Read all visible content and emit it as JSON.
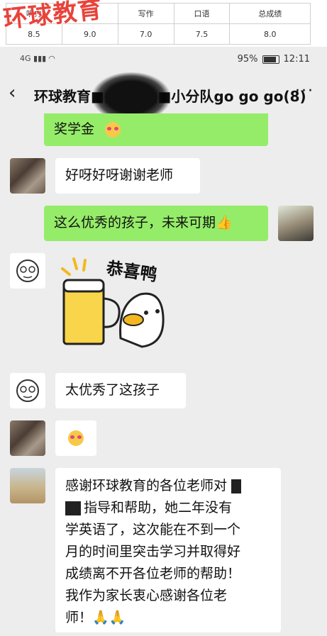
{
  "score_table": {
    "headers": [
      "听力",
      "阅读",
      "写作",
      "口语",
      "总成绩"
    ],
    "values": [
      "8.5",
      "9.0",
      "7.0",
      "7.5",
      "8.0"
    ]
  },
  "brand": {
    "text": "环球教育"
  },
  "status_bar": {
    "signal": "4G",
    "battery": "95%",
    "time": "12:11"
  },
  "chat": {
    "back_icon": "chevron-left-icon",
    "title": "环球教育■■■■■■小分队go go go(8)",
    "more": "···"
  },
  "messages": {
    "m1": "奖学金",
    "m2": "好呀好呀谢谢老师",
    "m3": "这么优秀的孩子，未来可期👍",
    "sticker_text": "恭喜鸭",
    "m5": "太优秀了这孩子",
    "m7_l1": "感谢环球教育的各位老师对",
    "m7_l2": "指导和帮助，她二年没有",
    "m7_l3": "学英语了，这次能在不到一个",
    "m7_l4": "月的时间里突击学习并取得好",
    "m7_l5": "成绩离不开各位老师的帮助！",
    "m7_l6": "我作为家长衷心感谢各位老",
    "m7_l7": "师！🙏🙏"
  },
  "colors": {
    "green_bubble": "#95ec69",
    "white_bubble": "#ffffff",
    "background": "#ededed",
    "brand": "#e8433a"
  }
}
